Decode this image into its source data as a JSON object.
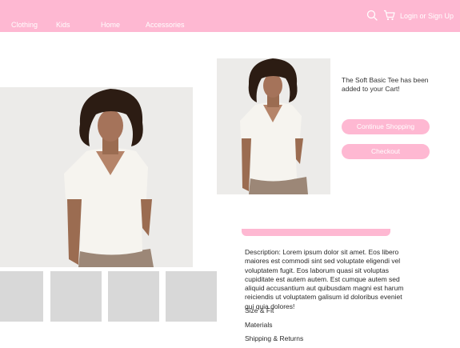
{
  "nav": {
    "links": [
      "Clothing",
      "Kids",
      "Home",
      "Accessories"
    ],
    "login_label": "Login or Sign Up",
    "search_icon": "search-icon",
    "cart_icon": "cart-icon"
  },
  "colors": {
    "brand_pink": "#feb8d2",
    "placeholder_gray": "#d8d8d8"
  },
  "product": {
    "main_image_icon": "model-photo",
    "thumbnails_count_note": "placeholder"
  },
  "cart_modal": {
    "message": "The Soft Basic Tee has been added to your Cart!",
    "continue_label": "Continue Shopping",
    "checkout_label": "Checkout"
  },
  "details": {
    "description": "Description: Lorem ipsum dolor sit amet. Eos libero maiores est commodi sint sed voluptate eligendi vel voluptatem fugit. Eos laborum quasi sit voluptas cupiditate est autem autem. Est cumque autem sed aliquid accusantium aut quibusdam magni est harum reiciendis ut voluptatem galisum id doloribus eveniet qui quia dolores!",
    "accordions": [
      "Size & Fit",
      "Materials",
      "Shipping & Returns"
    ]
  }
}
